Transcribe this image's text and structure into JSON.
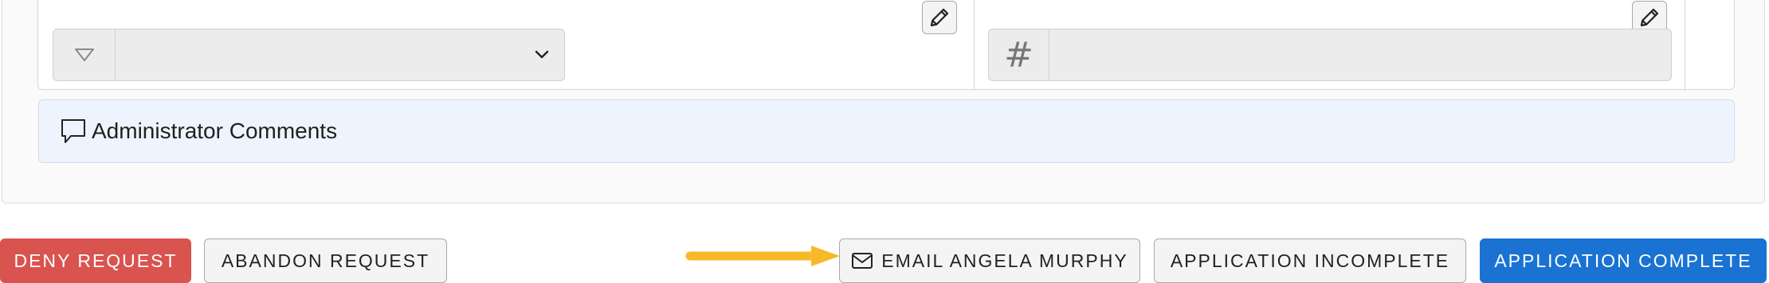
{
  "fields": {
    "select_value": "",
    "number_placeholder": "",
    "number_addon": "#"
  },
  "comments": {
    "label": "Administrator Comments"
  },
  "actions": {
    "deny_label": "DENY REQUEST",
    "abandon_label": "ABANDON REQUEST",
    "email_label": "EMAIL ANGELA MURPHY",
    "incomplete_label": "APPLICATION INCOMPLETE",
    "complete_label": "APPLICATION COMPLETE"
  },
  "colors": {
    "deny": "#d9534f",
    "complete": "#1a73d2",
    "comments_bg": "#eef4fd",
    "arrow": "#f7b928"
  },
  "icons": {
    "edit": "pencil-icon",
    "select_addon": "triangle-down-outline-icon",
    "select_caret": "chevron-down-icon",
    "number_addon": "hash-icon",
    "comments": "speech-bubble-icon",
    "email": "envelope-icon",
    "pointer": "arrow-right-icon"
  }
}
